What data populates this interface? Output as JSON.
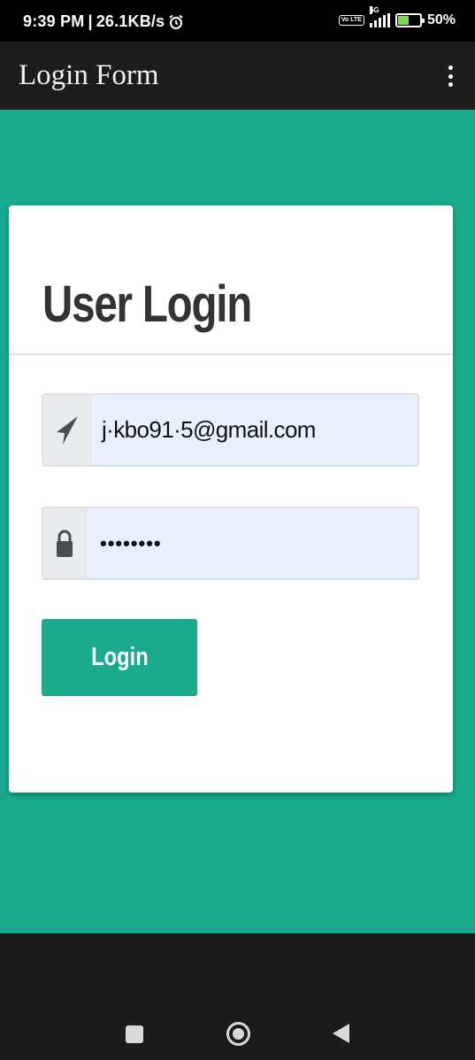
{
  "status_bar": {
    "time": "9:39 PM",
    "separator": "|",
    "net_speed": "26.1KB/s",
    "alarm_icon": "alarm-clock-icon",
    "volte": "Vo LTE",
    "network": "5G",
    "battery": "50%",
    "battery_icon": "battery-charging-icon"
  },
  "app_bar": {
    "title": "Login Form",
    "menu_icon": "overflow-menu-icon"
  },
  "login_card": {
    "heading": "User Login",
    "email": {
      "icon": "paper-plane-icon",
      "value": "j·kbo91·5@gmail.com"
    },
    "password": {
      "icon": "lock-icon",
      "value": "••••••••"
    },
    "button_label": "Login"
  },
  "colors": {
    "accent": "#19a98c",
    "app_bar": "#1c1d1d",
    "input_bg": "#e8f0fe",
    "heading": "#333333"
  },
  "nav_bar": {
    "recents_icon": "square-recents-icon",
    "home_icon": "circle-home-icon",
    "back_icon": "triangle-back-icon"
  }
}
